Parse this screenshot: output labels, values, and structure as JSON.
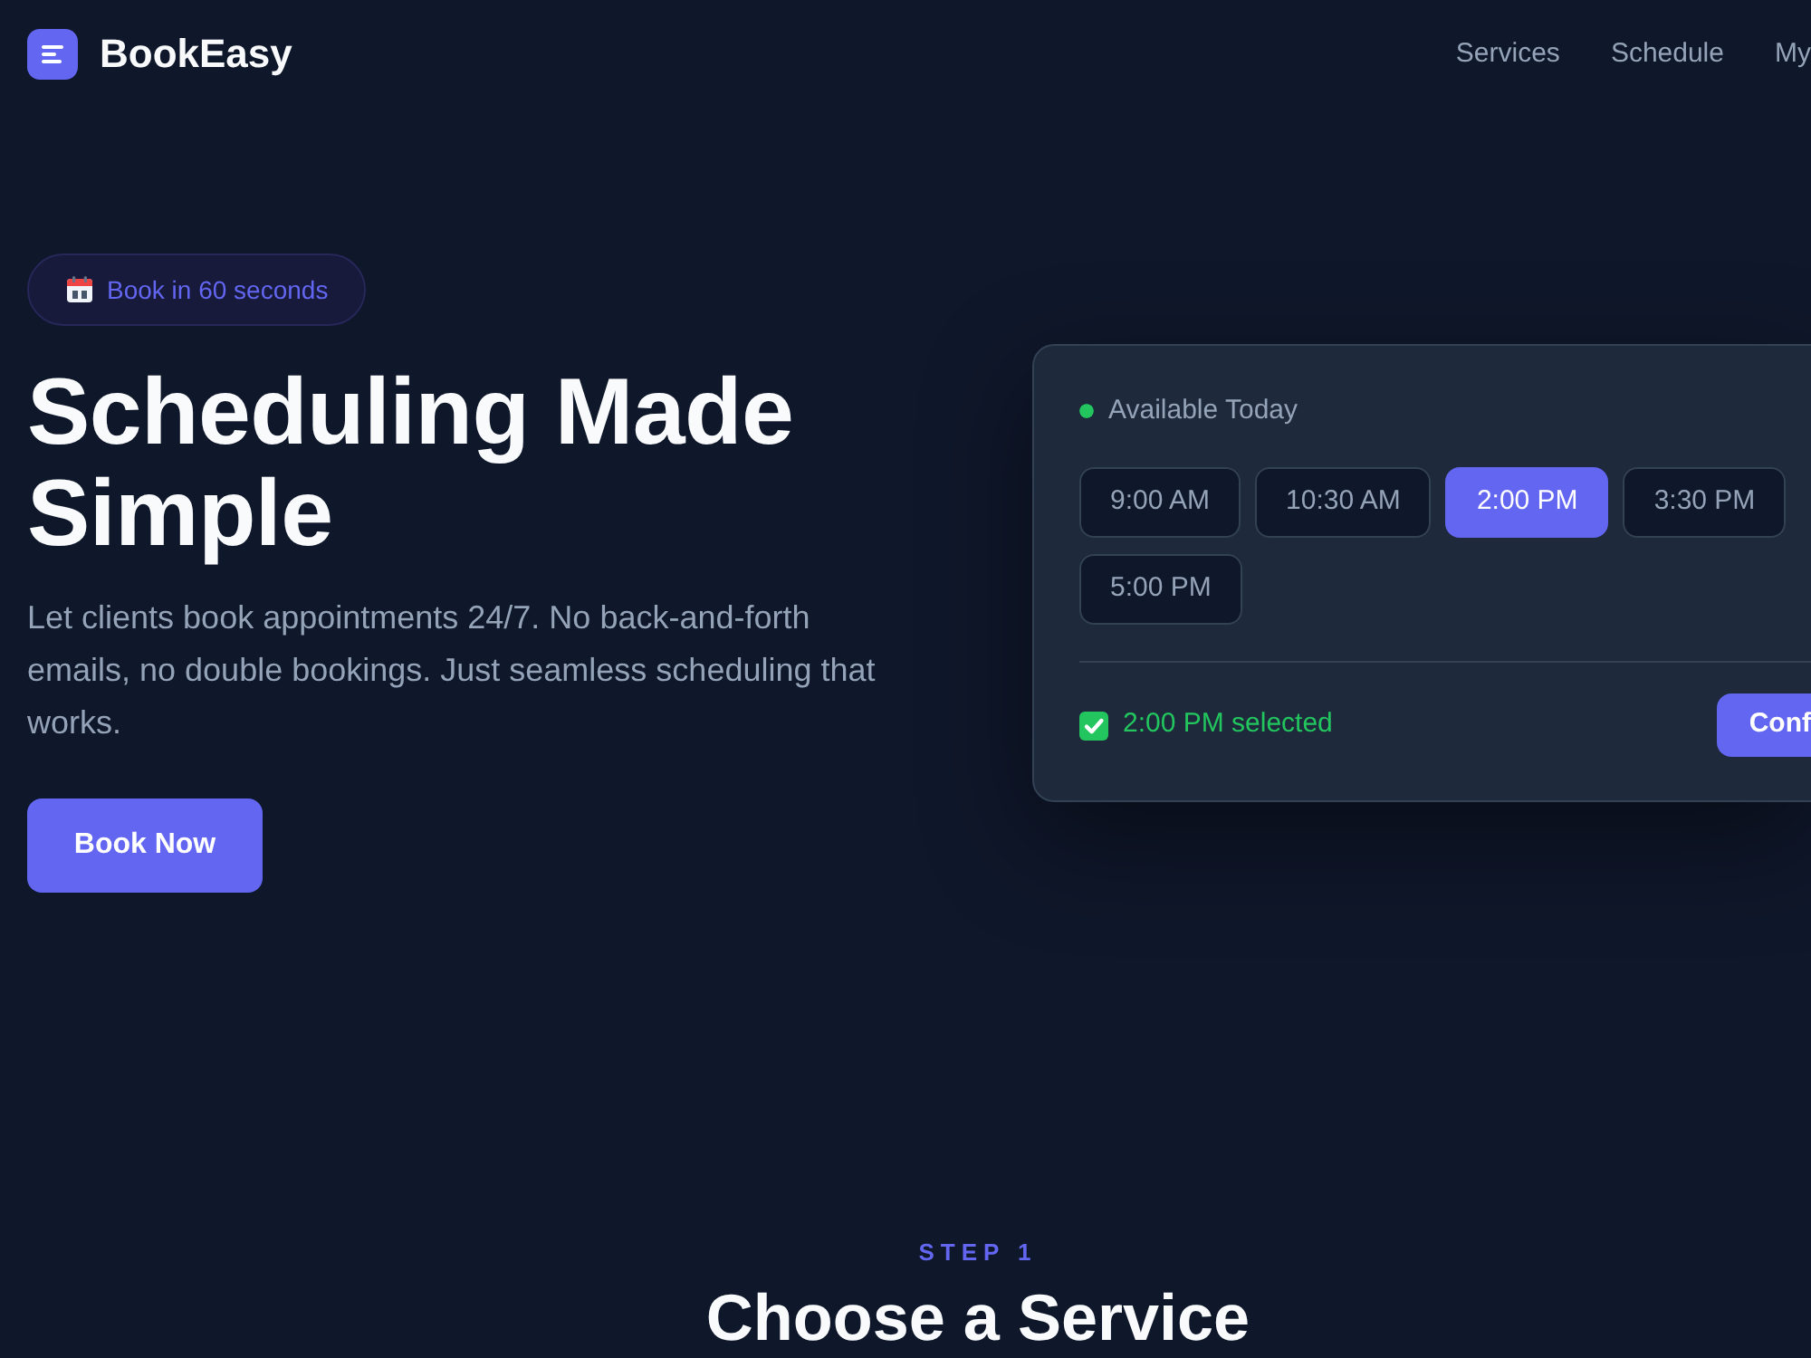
{
  "navbar": {
    "brand": "BookEasy",
    "links": [
      {
        "label": "Services"
      },
      {
        "label": "Schedule"
      },
      {
        "label": "My"
      }
    ]
  },
  "hero": {
    "badge": "Book in 60 seconds",
    "title": "Scheduling Made Simple",
    "lead": "Let clients book appointments 24/7. No back-and-forth emails, no double bookings. Just seamless scheduling that works.",
    "button": "Book Now"
  },
  "booking_card": {
    "status": "Available Today",
    "slots": [
      {
        "label": "9:00 AM",
        "selected": false
      },
      {
        "label": "10:30 AM",
        "selected": false
      },
      {
        "label": "2:00 PM",
        "selected": true
      },
      {
        "label": "3:30 PM",
        "selected": false
      },
      {
        "label": "5:00 PM",
        "selected": false
      }
    ],
    "selection": "2:00 PM selected",
    "confirm": "Conf"
  },
  "next_section": {
    "eyebrow": "STEP 1",
    "title": "Choose a Service"
  }
}
